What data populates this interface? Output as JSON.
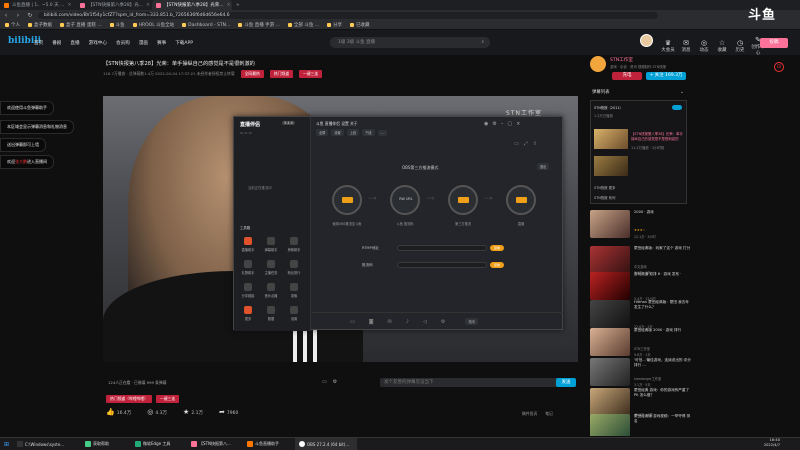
{
  "browser": {
    "tabs": [
      {
        "label": "斗鱼直播 | 1、~5.0 天 ..."
      },
      {
        "label": "【STN快报第八季28】光..."
      },
      {
        "label": "【STN快报第八季28】光荣..."
      }
    ],
    "url": "bilibili.com/video/BV1f54y1cfZT?spm_id_from=333.851.b_7265636f6d6d656e64.6",
    "bookmarks": [
      "个人",
      "盒子数据",
      "盒子 直播 蛋糕 ...",
      "斗鱼",
      "HROOL 斗鱼全站",
      "Dashboard - STN...",
      "斗鱼 直播 手游 ...",
      "全部 斗鱼 ...",
      "分享",
      "已收藏"
    ]
  },
  "site": {
    "logo": "bilibili",
    "nav": [
      "首页",
      "番剧",
      "直播",
      "游戏中心",
      "会员购",
      "漫画",
      "赛事",
      "下载APP"
    ],
    "search_placeholder": "1级 3级 斗鱼 直播",
    "header_icons": [
      {
        "icon": "bell-icon",
        "label": "大会员"
      },
      {
        "icon": "message-icon",
        "label": "消息"
      },
      {
        "icon": "dynamic-icon",
        "label": "动态"
      },
      {
        "icon": "star-icon",
        "label": "收藏"
      },
      {
        "icon": "history-icon",
        "label": "历史"
      },
      {
        "icon": "creative-icon",
        "label": "创作中心"
      }
    ],
    "upload_label": "投稿"
  },
  "video": {
    "title": "【STN快报第八季28】光荣：单手操纵自己的感觉是不是很刺激的",
    "meta": "116.7万播放 · 总弹幕数1.4万   2022-04-04 17:37:21   未经作者授权禁止转载",
    "title_tags": [
      "全网最热",
      "热门频道",
      "一键三连"
    ],
    "studio_text": "STN工作室",
    "danmaku_count": "124人正在看 · 已装填 999 条弹幕",
    "danmaku_placeholder": "发个友善的弹幕见证当下",
    "send_label": "发送",
    "bottom_tags": [
      "热门频道（哔哩哔哩）",
      "一键三连"
    ],
    "actions": [
      {
        "icon": "like-icon",
        "value": "16.4万"
      },
      {
        "icon": "coin-icon",
        "value": "4.3万"
      },
      {
        "icon": "fav-icon",
        "value": "2.1万"
      },
      {
        "icon": "share-icon",
        "value": "7960"
      }
    ],
    "report": "稿件投诉",
    "note": "笔记"
  },
  "overlays": [
    {
      "text": "欢迎使用斗鱼弹幕助手"
    },
    {
      "text": "本区域会显示弹幕消息和礼物消息"
    },
    {
      "text": "送出弹幕即可上墙"
    },
    {
      "prefix": "欢迎",
      "highlight": "张大鹏",
      "suffix": "进入直播间"
    }
  ],
  "obs": {
    "brand": "直播伴侣",
    "version": "3.4.0",
    "header": "斗鱼 直播伴侣 设置 关于",
    "buttons": [
      "全屏",
      "设置",
      "上线",
      "下线",
      "...",
      "关闭"
    ],
    "mode_title": "OBS第三方推流模式",
    "exit_label": "退出",
    "nodes": [
      {
        "label": "打开OBS"
      },
      {
        "label": "RW URL"
      },
      {
        "label": "第三方推流"
      },
      {
        "label": "直播"
      }
    ],
    "node_caption_1": "使用OBS推流至斗鱼",
    "node_caption_2": "斗鱼 推流码",
    "fields": [
      {
        "label": "RTMP地址",
        "btn": "复制"
      },
      {
        "label": "推流码",
        "btn": "复制"
      }
    ],
    "tools_title": "工具箱",
    "tools": [
      "直播助手",
      "弹幕助手",
      "房管助手",
      "礼物助手",
      "主播任务",
      "粉丝排行",
      "分享链接",
      "音乐点播",
      "录像",
      "更多",
      "数据",
      "设置"
    ],
    "footer_warning": "当前正在推流中"
  },
  "uploader": {
    "name": "STN工作室",
    "desc": "游戏 · 杂谈 · 资讯 视频制作 STN快报",
    "charge_label": "充电",
    "follow_label": "+ 关注 169.3万"
  },
  "sidebar": {
    "danmaku_list_title": "弹幕列表",
    "playlist_title": "STN快报（2011）",
    "playlist_progress": "1.2万已播放",
    "playlist_item_title": "【STN快报第八季28】光荣：单手操纵自己的感觉是不是很刺激的",
    "playlist_item_meta": "11.2万播放 · 2小时前",
    "more": "STN快报 更多",
    "more2": "STN快报 系列",
    "recommend": [
      {
        "title": "2000 · 游戏",
        "meta": "STN工作室",
        "stats": "12.1万 · 3小时"
      },
      {
        "title": "蒙田经典版：玩家了这个 游戏 打分",
        "meta": "中文游戏",
        "stats": "8.0万 · 1天"
      },
      {
        "title": "游戏频道 双排 6 · 游戏 发布 ·",
        "meta": "中文游戏",
        "stats": "5.4万 · 12小时"
      },
      {
        "title": "Hitman 蒙田经典版：蒙田 我去年 发生了什么？",
        "meta": "游戏频道",
        "stats": "22.6万 · 2天"
      },
      {
        "title": "蒙田经典版 2000 · 游戏 排行",
        "meta": "STN工作室",
        "stats": "9.6万 · 1天"
      },
      {
        "title": "'可怕...'最佳游戏，连续说出的 评分 排行 ...",
        "meta": "hamberger工作室",
        "stats": "3.1万 · 5天"
      },
      {
        "title": "蒙田经典 游戏：你的游戏有严重了 PK 怎么做？",
        "meta": "中文游戏",
        "stats": "45.1万 · 1周"
      },
      {
        "title": "蒙田经典版 游戏视频：一举夺得 排名",
        "meta": "STN工作室",
        "stats": "7.9万 · 3天"
      },
      {
        "title": "蒙田游戏 STN工作室 2000：游戏 排名 第...",
        "meta": "游戏频道",
        "stats": "2.6万 · 4天"
      }
    ]
  },
  "taskbar": {
    "items": [
      {
        "label": "C:\\Windows\\syste..."
      },
      {
        "label": "获取帮助"
      },
      {
        "label": "微软Edge 工具"
      },
      {
        "label": "【STN快报第八..."
      },
      {
        "label": "斗鱼直播助手"
      },
      {
        "label": "OBS 27.2.4 (64 bit)..."
      }
    ],
    "time": "16:40",
    "date": "2022/4/7"
  },
  "brand_corner": "斗鱼",
  "colors": {
    "accent_pink": "#fb7299",
    "accent_blue": "#00a1d6",
    "obs_orange": "#f0a018",
    "tag_red": "#c0223b"
  }
}
